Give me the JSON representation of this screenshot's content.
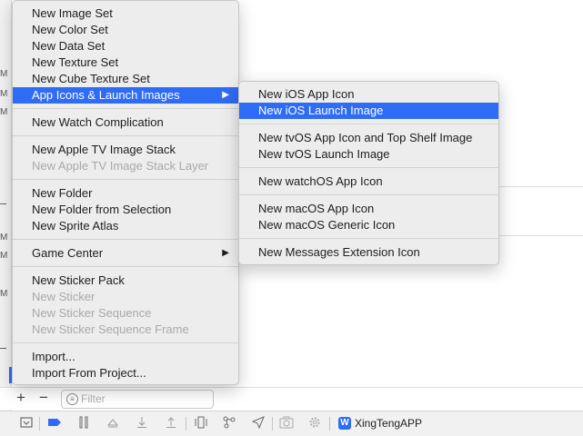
{
  "main_menu": {
    "items": [
      {
        "label": "New Image Set"
      },
      {
        "label": "New Color Set"
      },
      {
        "label": "New Data Set"
      },
      {
        "label": "New Texture Set"
      },
      {
        "label": "New Cube Texture Set"
      },
      {
        "label": "App Icons & Launch Images"
      },
      {
        "label": "New Watch Complication"
      },
      {
        "label": "New Apple TV Image Stack"
      },
      {
        "label": "New Apple TV Image Stack Layer"
      },
      {
        "label": "New Folder"
      },
      {
        "label": "New Folder from Selection"
      },
      {
        "label": "New Sprite Atlas"
      },
      {
        "label": "Game Center"
      },
      {
        "label": "New Sticker Pack"
      },
      {
        "label": "New Sticker"
      },
      {
        "label": "New Sticker Sequence"
      },
      {
        "label": "New Sticker Sequence Frame"
      },
      {
        "label": "Import..."
      },
      {
        "label": "Import From Project..."
      }
    ],
    "submenu_arrow": "▶"
  },
  "sub_menu": {
    "items": [
      {
        "label": "New iOS App Icon"
      },
      {
        "label": "New iOS Launch Image"
      },
      {
        "label": "New tvOS App Icon and Top Shelf Image"
      },
      {
        "label": "New tvOS Launch Image"
      },
      {
        "label": "New watchOS App Icon"
      },
      {
        "label": "New macOS App Icon"
      },
      {
        "label": "New macOS Generic Icon"
      },
      {
        "label": "New Messages Extension Icon"
      }
    ]
  },
  "filter_bar": {
    "add_label": "+",
    "remove_label": "−",
    "filter_placeholder": "Filter"
  },
  "toolbar": {
    "app_badge": "W",
    "app_name": "XingTengAPP"
  },
  "left_strip": {
    "marker": "M"
  },
  "colors": {
    "highlight": "#2f6cf5",
    "menu_bg": "#ededed"
  }
}
